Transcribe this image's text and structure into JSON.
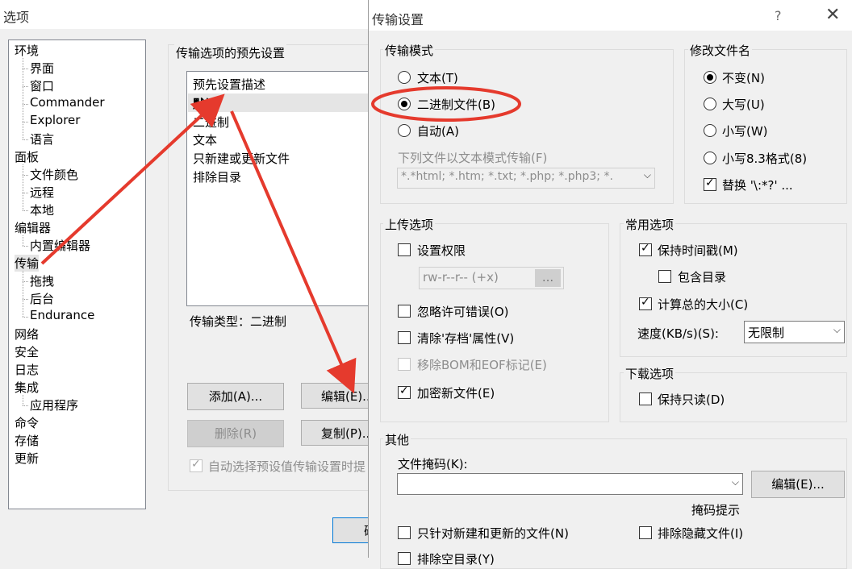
{
  "background_window": {
    "title": "选项",
    "tree": {
      "items": [
        {
          "label": "环境",
          "level": 0
        },
        {
          "label": "界面",
          "level": 1
        },
        {
          "label": "窗口",
          "level": 1
        },
        {
          "label": "Commander",
          "level": 1
        },
        {
          "label": "Explorer",
          "level": 1
        },
        {
          "label": "语言",
          "level": 1
        },
        {
          "label": "面板",
          "level": 0
        },
        {
          "label": "文件颜色",
          "level": 1
        },
        {
          "label": "远程",
          "level": 1
        },
        {
          "label": "本地",
          "level": 1
        },
        {
          "label": "编辑器",
          "level": 0
        },
        {
          "label": "内置编辑器",
          "level": 1
        },
        {
          "label": "传输",
          "level": 0
        },
        {
          "label": "拖拽",
          "level": 1
        },
        {
          "label": "后台",
          "level": 1
        },
        {
          "label": "Endurance",
          "level": 1
        },
        {
          "label": "网络",
          "level": 0
        },
        {
          "label": "安全",
          "level": 0
        },
        {
          "label": "日志",
          "level": 0
        },
        {
          "label": "集成",
          "level": 0
        },
        {
          "label": "应用程序",
          "level": 1
        },
        {
          "label": "命令",
          "level": 0
        },
        {
          "label": "存储",
          "level": 0
        },
        {
          "label": "更新",
          "level": 0
        }
      ]
    },
    "presets_group_label": "传输选项的预先设置",
    "presets": [
      "预先设置描述",
      "默认",
      "二进制",
      "文本",
      "只新建或更新文件",
      "排除目录"
    ],
    "selected_preset": "默认",
    "transfer_type_text": "传输类型：二进制",
    "buttons": {
      "add": "添加(A)...",
      "edit": "编辑(E)...",
      "delete": "删除(R)",
      "copy": "复制(P)...",
      "ok_partial": "确"
    },
    "auto_select_label": "自动选择预设值传输设置时提"
  },
  "dialog": {
    "title": "传输设置",
    "help_label": "?",
    "close_label": "✕",
    "transfer_mode": {
      "legend": "传输模式",
      "options": [
        "文本(T)",
        "二进制文件(B)",
        "自动(A)"
      ],
      "selected": "二进制文件(B)",
      "text_mode_label": "下列文件以文本模式传输(F)",
      "text_mode_value": "*.*html; *.htm; *.txt; *.php; *.php3; *.",
      "dropdown_arrow": "⌵"
    },
    "rename": {
      "legend": "修改文件名",
      "options": [
        "不变(N)",
        "大写(U)",
        "小写(W)",
        "小写8.3格式(8)"
      ],
      "selected": "不变(N)",
      "replace_label": "替换 '\\:*?' ...",
      "replace_checked": true
    },
    "upload": {
      "legend": "上传选项",
      "set_permissions": "设置权限",
      "permissions_value": "rw-r--r-- (+x)",
      "permissions_button": "...",
      "ignore_errors": "忽略许可错误(O)",
      "clear_archive": "清除'存档'属性(V)",
      "remove_bom": "移除BOM和EOF标记(E)",
      "encrypt": "加密新文件(E)",
      "encrypt_checked": true
    },
    "common": {
      "legend": "常用选项",
      "keep_timestamp": "保持时间戳(M)",
      "include_dirs": "包含目录",
      "calc_size": "计算总的大小(C)",
      "speed_label": "速度(KB/s)(S):",
      "speed_value": "无限制",
      "dropdown_arrow": "⌵"
    },
    "download": {
      "legend": "下载选项",
      "readonly": "保持只读(D)"
    },
    "other": {
      "legend": "其他",
      "mask_label": "文件掩码(K):",
      "mask_value": "",
      "mask_edit_button": "编辑(E)...",
      "mask_hint": "掩码提示",
      "only_new": "只针对新建和更新的文件(N)",
      "exclude_hidden": "排除隐藏文件(I)",
      "partial_label": "排除空目录(Y)",
      "dropdown_arrow": "⌵"
    }
  },
  "colors": {
    "annotation_red": "#e53a2d",
    "selection_gray": "#e5e5e5"
  }
}
